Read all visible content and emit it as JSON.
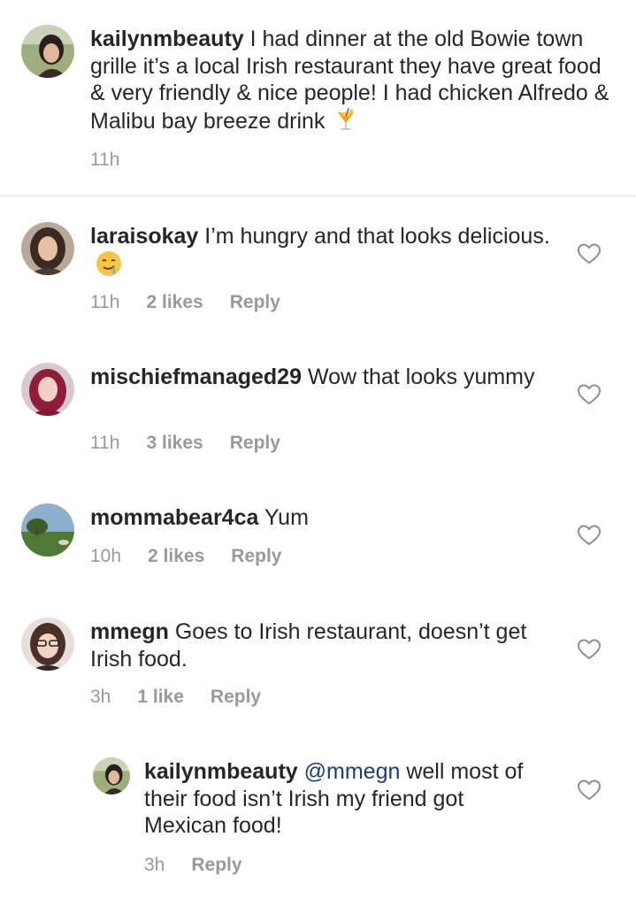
{
  "caption": {
    "username": "kailynmbeauty",
    "text": "I had dinner at the old Bowie town grille it’s a local Irish restaurant they have great food & very friendly & nice people! I had chicken Alfredo & Malibu bay breeze drink",
    "time": "11h",
    "emoji": "tropical-drink"
  },
  "comments": [
    {
      "username": "laraisokay",
      "text": "I’m hungry and that looks delicious.",
      "emoji": "drooling-face",
      "time": "11h",
      "likes": "2 likes",
      "reply": "Reply"
    },
    {
      "username": "mischiefmanaged29",
      "text": "Wow that looks yummy",
      "time": "11h",
      "likes": "3 likes",
      "reply": "Reply"
    },
    {
      "username": "mommabear4ca",
      "text": "Yum",
      "time": "10h",
      "likes": "2 likes",
      "reply": "Reply"
    },
    {
      "username": "mmegn",
      "text": "Goes to Irish restaurant, doesn’t get Irish food.",
      "time": "3h",
      "likes": "1 like",
      "reply": "Reply"
    }
  ],
  "reply_comment": {
    "username": "kailynmbeauty",
    "mention": "@mmegn",
    "text": "well most of their food isn’t Irish my friend got Mexican food!",
    "time": "3h",
    "reply": "Reply"
  },
  "colors": {
    "text": "#262626",
    "muted": "#999999",
    "mention": "#1c3e6e",
    "divider": "#e3e3e3"
  }
}
